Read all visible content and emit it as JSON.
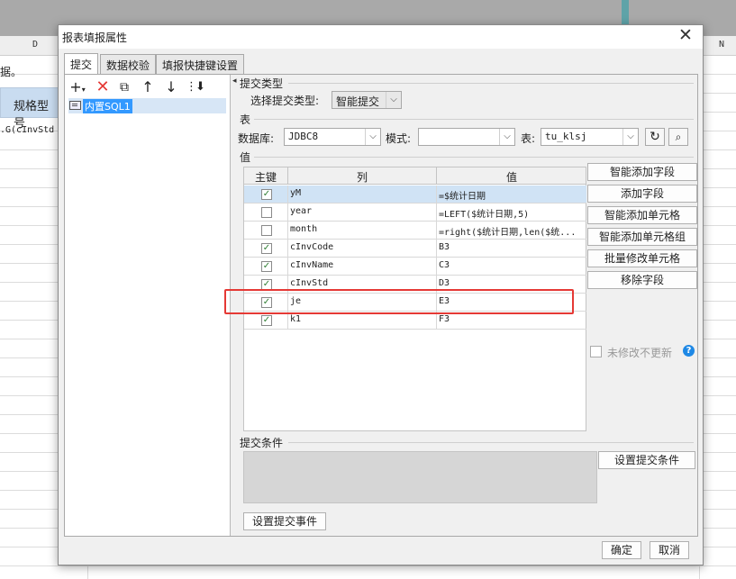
{
  "background": {
    "column_headers": [
      "D",
      "N"
    ],
    "text_row1": "据。",
    "header_cell": "规格型号",
    "formula_cell": ".G(cInvStd"
  },
  "dialog": {
    "title": "报表填报属性",
    "close_glyph": "✕",
    "tabs": [
      "提交",
      "数据校验",
      "填报快捷键设置"
    ],
    "tree": {
      "item": "内置SQL1"
    },
    "submit_type": {
      "section": "提交类型",
      "label": "选择提交类型:",
      "value": "智能提交"
    },
    "table_section": {
      "section": "表",
      "db_label": "数据库:",
      "db_value": "JDBC8",
      "mode_label": "模式:",
      "mode_value": "",
      "table_label": "表:",
      "table_value": "tu_klsj"
    },
    "value_section": "值",
    "grid": {
      "headers": {
        "key": "主键",
        "col": "列",
        "val": "值"
      },
      "rows": [
        {
          "checked": true,
          "col": "yM",
          "val": "=$统计日期",
          "selected": true
        },
        {
          "checked": false,
          "col": "year",
          "val": "=LEFT($统计日期,5)"
        },
        {
          "checked": false,
          "col": "month",
          "val": "=right($统计日期,len($统..."
        },
        {
          "checked": true,
          "col": "cInvCode",
          "val": "B3"
        },
        {
          "checked": true,
          "col": "cInvName",
          "val": "C3"
        },
        {
          "checked": true,
          "col": "cInvStd",
          "val": "D3"
        },
        {
          "checked": true,
          "col": "je",
          "val": "E3"
        },
        {
          "checked": true,
          "col": "k1",
          "val": "F3"
        }
      ]
    },
    "side_buttons": [
      "智能添加字段",
      "添加字段",
      "智能添加单元格",
      "智能添加单元格组",
      "批量修改单元格",
      "移除字段"
    ],
    "no_update_label": "未修改不更新",
    "help_glyph": "?",
    "condition_section": "提交条件",
    "set_condition_button": "设置提交条件",
    "set_event_button": "设置提交事件",
    "ok_button": "确定",
    "cancel_button": "取消"
  }
}
